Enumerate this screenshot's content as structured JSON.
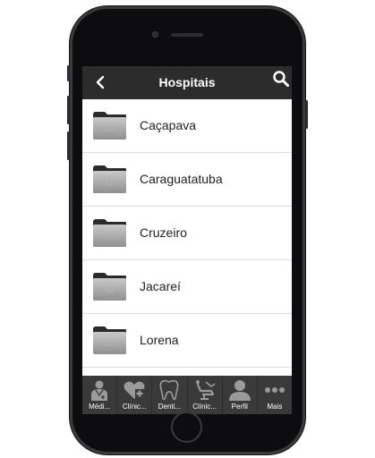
{
  "header": {
    "title": "Hospitais"
  },
  "hospitals": [
    {
      "label": "Caçapava"
    },
    {
      "label": "Caraguatatuba"
    },
    {
      "label": "Cruzeiro"
    },
    {
      "label": "Jacareí"
    },
    {
      "label": "Lorena"
    }
  ],
  "tabs": [
    {
      "label": "Médi...",
      "icon": "doctor-icon"
    },
    {
      "label": "Clínic...",
      "icon": "heart-plus-icon"
    },
    {
      "label": "Denti...",
      "icon": "tooth-icon"
    },
    {
      "label": "Clínic...",
      "icon": "dental-chair-icon"
    },
    {
      "label": "Perfil",
      "icon": "profile-icon"
    },
    {
      "label": "Mais",
      "icon": "more-icon"
    }
  ],
  "colors": {
    "header_bg": "#2c2c2c",
    "tabbar_bg": "#3a3a3a",
    "icon_gray": "#9a9a9a"
  }
}
